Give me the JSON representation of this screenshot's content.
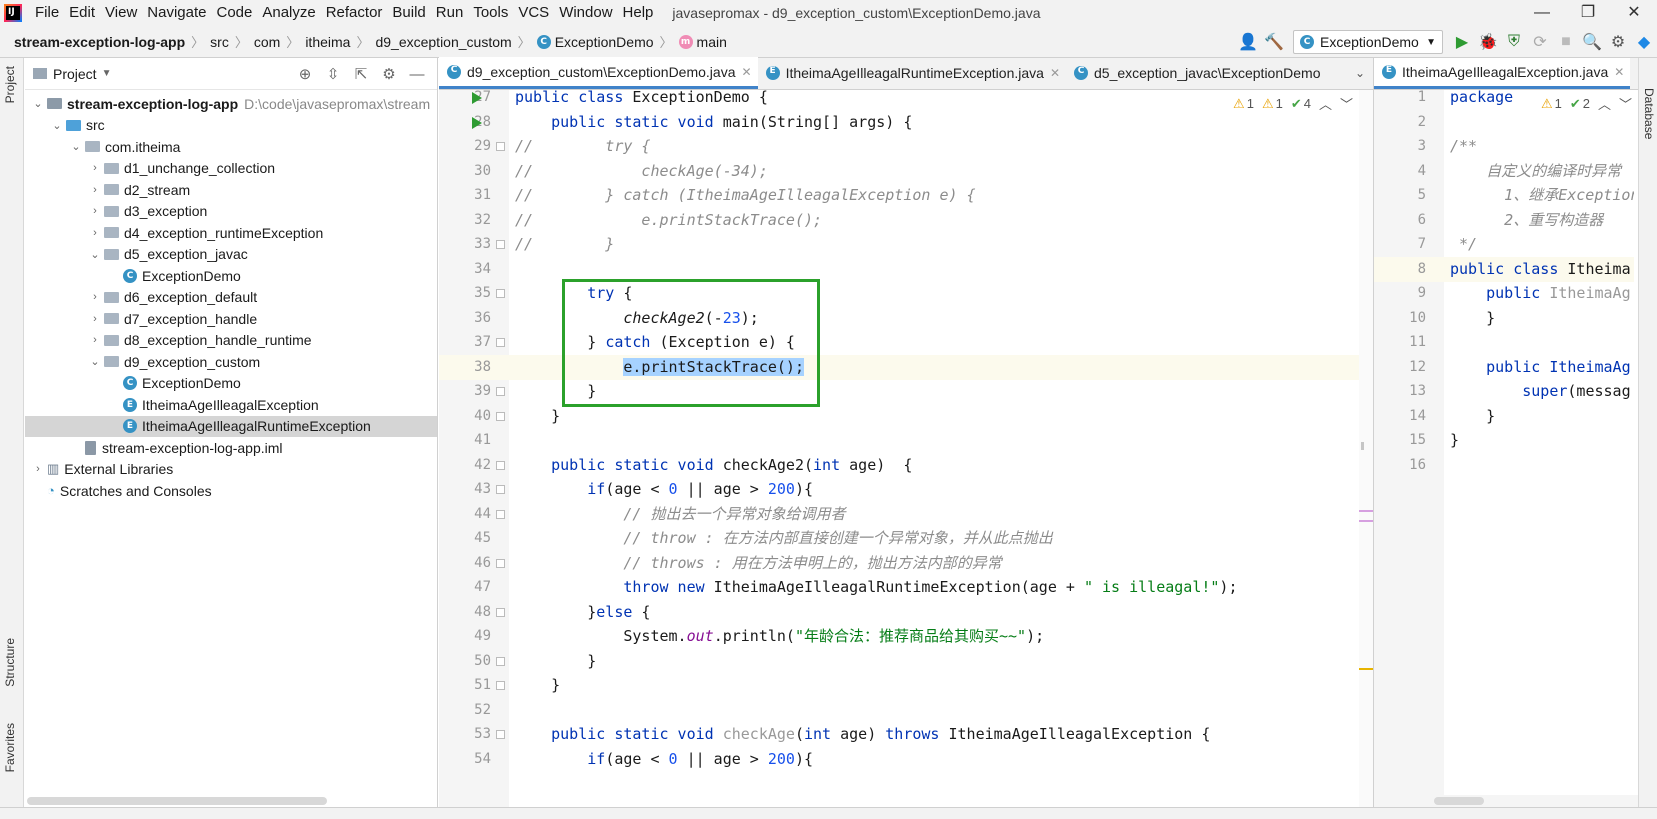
{
  "menu": [
    "File",
    "Edit",
    "View",
    "Navigate",
    "Code",
    "Analyze",
    "Refactor",
    "Build",
    "Run",
    "Tools",
    "VCS",
    "Window",
    "Help"
  ],
  "window_title": "javasepromax - d9_exception_custom\\ExceptionDemo.java",
  "breadcrumb": [
    "stream-exception-log-app",
    "src",
    "com",
    "itheima",
    "d9_exception_custom",
    "ExceptionDemo",
    "main"
  ],
  "run_config": "ExceptionDemo",
  "left_strip": {
    "project": "Project",
    "structure": "Structure",
    "favorites": "Favorites"
  },
  "right_strip": {
    "database": "Database"
  },
  "project_panel": {
    "title": "Project",
    "tree": [
      {
        "label": "stream-exception-log-app",
        "path": "D:\\code\\javasepromax\\stream",
        "indent": 0,
        "arrow": "▾",
        "icon": "root",
        "bold": true
      },
      {
        "label": "src",
        "indent": 1,
        "arrow": "▾",
        "icon": "src"
      },
      {
        "label": "com.itheima",
        "indent": 2,
        "arrow": "▾",
        "icon": "pkg"
      },
      {
        "label": "d1_unchange_collection",
        "indent": 3,
        "arrow": "▸",
        "icon": "pkg"
      },
      {
        "label": "d2_stream",
        "indent": 3,
        "arrow": "▸",
        "icon": "pkg"
      },
      {
        "label": "d3_exception",
        "indent": 3,
        "arrow": "▸",
        "icon": "pkg"
      },
      {
        "label": "d4_exception_runtimeException",
        "indent": 3,
        "arrow": "▸",
        "icon": "pkg"
      },
      {
        "label": "d5_exception_javac",
        "indent": 3,
        "arrow": "▾",
        "icon": "pkg"
      },
      {
        "label": "ExceptionDemo",
        "indent": 4,
        "arrow": "",
        "icon": "class"
      },
      {
        "label": "d6_exception_default",
        "indent": 3,
        "arrow": "▸",
        "icon": "pkg"
      },
      {
        "label": "d7_exception_handle",
        "indent": 3,
        "arrow": "▸",
        "icon": "pkg"
      },
      {
        "label": "d8_exception_handle_runtime",
        "indent": 3,
        "arrow": "▸",
        "icon": "pkg"
      },
      {
        "label": "d9_exception_custom",
        "indent": 3,
        "arrow": "▾",
        "icon": "pkg"
      },
      {
        "label": "ExceptionDemo",
        "indent": 4,
        "arrow": "",
        "icon": "class"
      },
      {
        "label": "ItheimaAgeIlleagalException",
        "indent": 4,
        "arrow": "",
        "icon": "exc"
      },
      {
        "label": "ItheimaAgeIlleagalRuntimeException",
        "indent": 4,
        "arrow": "",
        "icon": "exc",
        "selected": true
      },
      {
        "label": "stream-exception-log-app.iml",
        "indent": 2,
        "arrow": "",
        "icon": "file"
      },
      {
        "label": "External Libraries",
        "indent": 0,
        "arrow": "▸",
        "icon": "lib"
      },
      {
        "label": "Scratches and Consoles",
        "indent": 0,
        "arrow": "",
        "icon": "scratch"
      }
    ]
  },
  "editor_tabs": [
    {
      "label": "d9_exception_custom\\ExceptionDemo.java",
      "active": true,
      "closable": true,
      "icon": "C"
    },
    {
      "label": "ItheimaAgeIlleagalRuntimeException.java",
      "active": false,
      "closable": true,
      "icon": "E"
    },
    {
      "label": "d5_exception_javac\\ExceptionDemo",
      "active": false,
      "closable": false,
      "icon": "C"
    }
  ],
  "inspections": {
    "warn1": "1",
    "warn2": "1",
    "ok": "4"
  },
  "code_lines": [
    {
      "n": "27",
      "run": true,
      "html": "<span class='kw'>public class</span> ExceptionDemo {"
    },
    {
      "n": "28",
      "run": true,
      "html": "    <span class='kw'>public static void</span> main(String[] args) {"
    },
    {
      "n": "29",
      "html": "<span class='cm'>//        try {</span>"
    },
    {
      "n": "30",
      "html": "<span class='cm'>//            checkAge(-34);</span>"
    },
    {
      "n": "31",
      "html": "<span class='cm'>//        } catch (ItheimaAgeIlleagalException e) {</span>"
    },
    {
      "n": "32",
      "html": "<span class='cm'>//            e.printStackTrace();</span>"
    },
    {
      "n": "33",
      "html": "<span class='cm'>//        }</span>"
    },
    {
      "n": "34",
      "html": ""
    },
    {
      "n": "35",
      "html": "        <span class='kw'>try</span> {"
    },
    {
      "n": "36",
      "html": "            <span class='it'>checkAge2</span>(-<span class='num'>23</span>);"
    },
    {
      "n": "37",
      "html": "        } <span class='kw'>catch</span> (Exception e) {"
    },
    {
      "n": "38",
      "html": "            <span class='sel-text'>e.printStackTrace();</span>"
    },
    {
      "n": "39",
      "html": "        }"
    },
    {
      "n": "40",
      "html": "    }"
    },
    {
      "n": "41",
      "html": ""
    },
    {
      "n": "42",
      "html": "    <span class='kw'>public static void</span> checkAge2(<span class='kw'>int</span> age)  {"
    },
    {
      "n": "43",
      "html": "        <span class='kw'>if</span>(age &lt; <span class='num'>0</span> || age &gt; <span class='num'>200</span>){"
    },
    {
      "n": "44",
      "html": "            <span class='cm'>// 抛出去一个异常对象给调用者</span>"
    },
    {
      "n": "45",
      "html": "            <span class='cm'>// throw : 在方法内部直接创建一个异常对象，并从此点抛出</span>"
    },
    {
      "n": "46",
      "html": "            <span class='cm'>// throws : 用在方法申明上的，抛出方法内部的异常</span>"
    },
    {
      "n": "47",
      "html": "            <span class='kw'>throw new</span> ItheimaAgeIlleagalRuntimeException(age + <span class='str'>\" is illeagal!\"</span>);"
    },
    {
      "n": "48",
      "html": "        }<span class='kw'>else</span> {"
    },
    {
      "n": "49",
      "html": "            System.<span class='fld'>out</span>.println(<span class='str'>\"年龄合法：推荐商品给其购买~~\"</span>);"
    },
    {
      "n": "50",
      "html": "        }"
    },
    {
      "n": "51",
      "html": "    }"
    },
    {
      "n": "52",
      "html": ""
    },
    {
      "n": "53",
      "html": "    <span class='kw'>public static void</span> <span style='color:#999'>checkAge</span>(<span class='kw'>int</span> age) <span class='kw'>throws</span> ItheimaAgeIlleagalException {"
    },
    {
      "n": "54",
      "html": "        <span class='kw'>if</span>(age &lt; <span class='num'>0</span> || age &gt; <span class='num'>200</span>){"
    }
  ],
  "editor2": {
    "tab": "ItheimaAgeIlleagalException.java",
    "inspections": {
      "warn": "1",
      "ok": "2"
    },
    "lines": [
      {
        "n": "1",
        "html": "<span class='kw'>package</span>"
      },
      {
        "n": "2",
        "html": ""
      },
      {
        "n": "3",
        "html": "<span class='cm'>/**</span>"
      },
      {
        "n": "4",
        "html": "<span class='cm'>    自定义的编译时异常</span>"
      },
      {
        "n": "5",
        "html": "<span class='cm'>      1、继承Exception</span>"
      },
      {
        "n": "6",
        "html": "<span class='cm'>      2、重写构造器</span>"
      },
      {
        "n": "7",
        "html": "<span class='cm'> */</span>"
      },
      {
        "n": "8",
        "html": "<span class='kw'>public class</span> Itheima"
      },
      {
        "n": "9",
        "html": "    <span class='kw'>public</span> <span style='color:#999'>ItheimaAg</span>"
      },
      {
        "n": "10",
        "html": "    }"
      },
      {
        "n": "11",
        "html": ""
      },
      {
        "n": "12",
        "html": "    <span class='kw'>public</span> <span style='color:#0033b3'>ItheimaAg</span>"
      },
      {
        "n": "13",
        "html": "        <span class='kw'>super</span>(messag"
      },
      {
        "n": "14",
        "html": "    }"
      },
      {
        "n": "15",
        "html": "}"
      },
      {
        "n": "16",
        "html": ""
      }
    ]
  }
}
